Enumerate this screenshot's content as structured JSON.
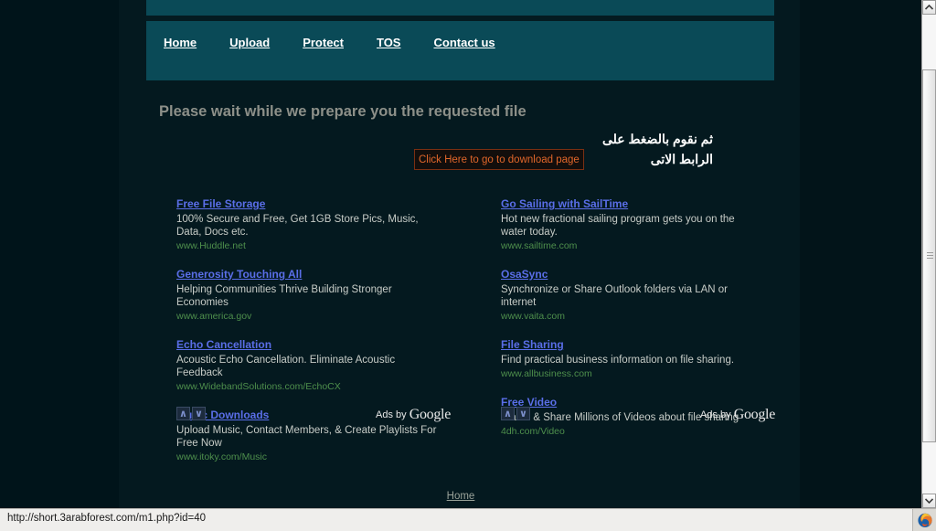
{
  "nav": {
    "items": [
      {
        "label": "Home"
      },
      {
        "label": "Upload"
      },
      {
        "label": "Protect"
      },
      {
        "label": "TOS"
      },
      {
        "label": "Contact us"
      }
    ]
  },
  "main": {
    "heading": "Please wait while we prepare you the requested file",
    "arabic_line1": "ثم نقوم بالضغط على",
    "arabic_line2": "الرابط الاتى",
    "click_here_label": "Click Here to go to download page"
  },
  "ads": {
    "left_column": [
      {
        "title": "Free File Storage",
        "description": "100% Secure and Free, Get 1GB Store Pics, Music, Data, Docs etc.",
        "url": "www.Huddle.net"
      },
      {
        "title": "Generosity Touching All",
        "description": "Helping Communities Thrive Building Stronger Economies",
        "url": "www.america.gov"
      },
      {
        "title": "Echo Cancellation",
        "description": "Acoustic Echo Cancellation. Eliminate Acoustic Feedback",
        "url": "www.WidebandSolutions.com/EchoCX"
      },
      {
        "title": "Music Downloads",
        "description": "Upload Music, Contact Members, & Create Playlists For Free Now",
        "url": "www.itoky.com/Music"
      }
    ],
    "right_column": [
      {
        "title": "Go Sailing with SailTime",
        "description": "Hot new fractional sailing program gets you on the water today.",
        "url": "www.sailtime.com"
      },
      {
        "title": "OsaSync",
        "description": "Synchronize or Share Outlook folders via LAN or internet",
        "url": "www.vaita.com"
      },
      {
        "title": "File Sharing",
        "description": "Find practical business information on file sharing.",
        "url": "www.allbusiness.com"
      },
      {
        "title": "Free Video",
        "description": "Watch & Share Millions of Videos about file sharing",
        "url": "4dh.com/Video"
      }
    ],
    "prev_arrow": "∧",
    "next_arrow": "∨",
    "ads_by_text": "Ads by",
    "ads_by_brand": "Google"
  },
  "footer": {
    "home_label": "Home"
  },
  "statusbar": {
    "url": "http://short.3arabforest.com/m1.php?id=40"
  },
  "colors": {
    "nav_teal": "#0a4a57",
    "page_bg": "#04191f",
    "ad_title": "#5a6ee8",
    "ad_url": "#4e8f4c",
    "click_here": "#e0662a",
    "heading": "#8d9089"
  }
}
